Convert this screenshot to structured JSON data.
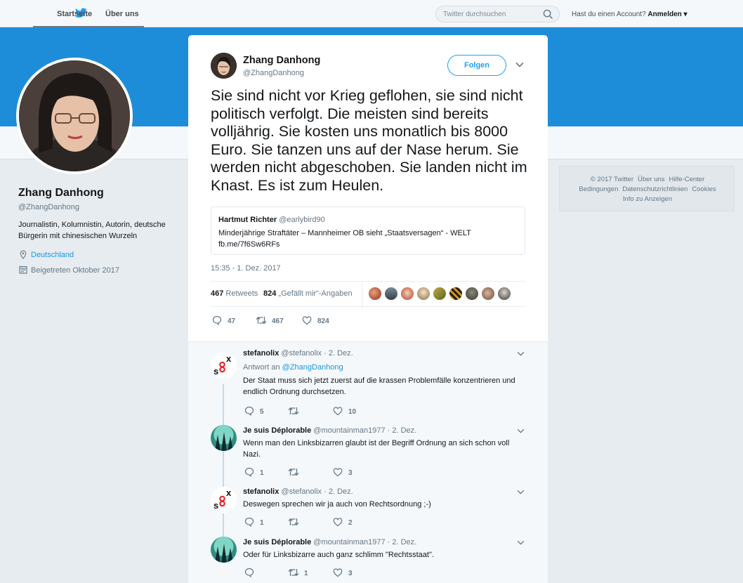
{
  "nav": {
    "home_label": "Startseite",
    "about_label": "Über uns",
    "search_placeholder": "Twitter durchsuchen",
    "account_prompt": "Hast du einen Account?",
    "login_label": "Anmelden"
  },
  "profile": {
    "name": "Zhang Danhong",
    "handle": "@ZhangDanhong",
    "bio": "Journalistin, Kolumnistin, Autorin, deutsche Bürgerin mit chinesischen Wurzeln",
    "location": "Deutschland",
    "joined": "Beigetreten Oktober 2017"
  },
  "footer": {
    "row1": [
      "© 2017 Twitter",
      "Über uns",
      "Hilfe-Center"
    ],
    "row2": [
      "Bedingungen",
      "Datenschutzrichtlinien",
      "Cookies"
    ],
    "row3": [
      "Info zu Anzeigen"
    ]
  },
  "tweet": {
    "name": "Zhang Danhong",
    "handle": "@ZhangDanhong",
    "follow_label": "Folgen",
    "text": "Sie sind nicht vor Krieg geflohen, sie sind nicht politisch verfolgt. Die meisten sind bereits volljährig. Sie kosten uns monatlich bis 8000 Euro. Sie tanzen uns auf der Nase herum. Sie werden nicht abgeschoben. Sie landen nicht im Knast. Es ist zum Heulen.",
    "quote": {
      "name": "Hartmut Richter",
      "handle": "@earlybird90",
      "text": "Minderjährige Straftäter – Mannheimer OB sieht „Staatsversagen“ - WELT fb.me/7f6Sw6RFs"
    },
    "timestamp": "15:35 - 1. Dez. 2017",
    "retweets_count": "467",
    "retweets_label": "Retweets",
    "likes_count": "824",
    "likes_label": "„Gefällt mir“-Angaben",
    "actions": {
      "replies": "47",
      "retweets": "467",
      "likes": "824"
    }
  },
  "replies": [
    {
      "name": "stefanolix",
      "handle": "@stefanolix",
      "date": "· 2. Dez.",
      "reply_to_prefix": "Antwort an",
      "reply_to_handle": "@ZhangDanhong",
      "text": "Der Staat muss sich jetzt zuerst auf die krassen Problemfälle konzentrieren und endlich Ordnung durchsetzen.",
      "replies": "5",
      "retweets": "",
      "likes": "10"
    },
    {
      "name": "Je suis Déplorable",
      "handle": "@mountainman1977",
      "date": "· 2. Dez.",
      "text": "Wenn man den Linksbizarren glaubt ist der Begriff Ordnung an sich schon voll Nazi.",
      "replies": "1",
      "retweets": "",
      "likes": "3"
    },
    {
      "name": "stefanolix",
      "handle": "@stefanolix",
      "date": "· 2. Dez.",
      "text": "Deswegen sprechen wir ja auch von Rechtsordnung ;-)",
      "replies": "1",
      "retweets": "",
      "likes": "2"
    },
    {
      "name": "Je suis Déplorable",
      "handle": "@mountainman1977",
      "date": "· 2. Dez.",
      "text": "Oder für Linksbizarre auch ganz schlimm \"Rechtsstaat\".",
      "replies": "",
      "retweets": "1",
      "likes": "3"
    }
  ],
  "colors": {
    "accent": "#1da1f2",
    "banner": "#1d8dd9",
    "link": "#1b95e0"
  },
  "icons": [
    "twitter-bird-icon",
    "search-icon",
    "chevron-down-icon",
    "location-icon",
    "calendar-icon",
    "reply-icon",
    "retweet-icon",
    "like-icon"
  ]
}
